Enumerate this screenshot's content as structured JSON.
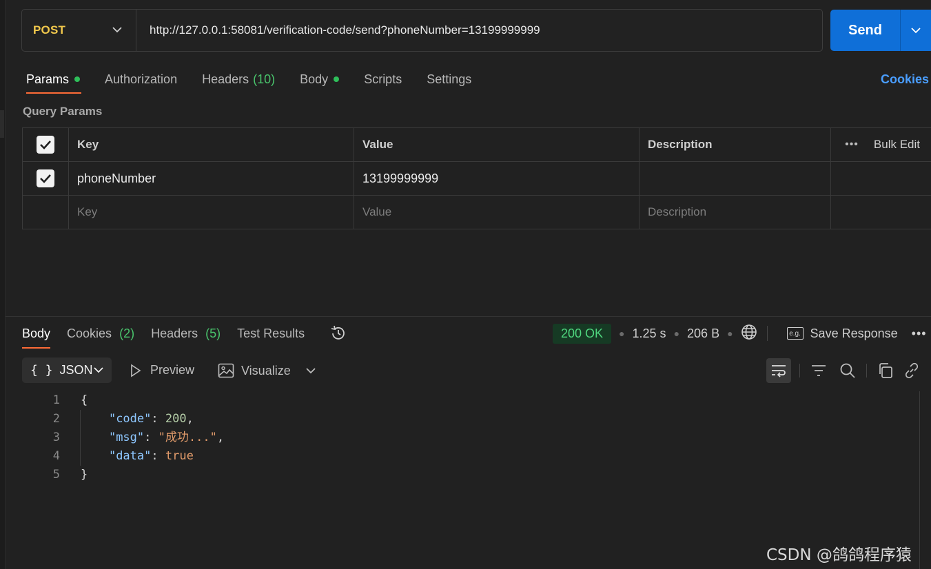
{
  "request": {
    "method": "POST",
    "url": "http://127.0.0.1:58081/verification-code/send?phoneNumber=13199999999",
    "send_label": "Send"
  },
  "request_tabs": [
    {
      "label": "Params",
      "dot": true,
      "active": true
    },
    {
      "label": "Authorization"
    },
    {
      "label": "Headers",
      "count": "(10)"
    },
    {
      "label": "Body",
      "dot": true
    },
    {
      "label": "Scripts"
    },
    {
      "label": "Settings"
    }
  ],
  "cookies_link": "Cookies",
  "query_params": {
    "title": "Query Params",
    "headers": {
      "key": "Key",
      "value": "Value",
      "description": "Description",
      "bulk_edit": "Bulk Edit"
    },
    "rows": [
      {
        "checked": true,
        "key": "phoneNumber",
        "value": "13199999999",
        "description": ""
      }
    ],
    "placeholder": {
      "key": "Key",
      "value": "Value",
      "description": "Description"
    }
  },
  "response_tabs": [
    {
      "label": "Body",
      "active": true
    },
    {
      "label": "Cookies",
      "count": "(2)"
    },
    {
      "label": "Headers",
      "count": "(5)"
    },
    {
      "label": "Test Results"
    }
  ],
  "response_meta": {
    "status": "200 OK",
    "time": "1.25 s",
    "size": "206 B",
    "save_label": "Save Response",
    "eg_label": "e.g."
  },
  "response_toolbar": {
    "format": "JSON",
    "format_braces": "{ }",
    "preview": "Preview",
    "visualize": "Visualize"
  },
  "code_lines": [
    {
      "n": "1",
      "text": "{"
    },
    {
      "n": "2",
      "text": "\"code\": 200,"
    },
    {
      "n": "3",
      "text": "\"msg\": \"成功...\","
    },
    {
      "n": "4",
      "text": "\"data\": true"
    },
    {
      "n": "5",
      "text": "}"
    }
  ],
  "code_tokens": {
    "code_key": "\"code\"",
    "code_val": "200",
    "msg_key": "\"msg\"",
    "msg_val": "\"成功...\"",
    "data_key": "\"data\"",
    "data_val": "true"
  },
  "watermark": "CSDN @鸽鸽程序猿",
  "colors": {
    "accent": "#ff6c37",
    "send": "#0f6fd8",
    "method": "#f2c94c",
    "status_ok": "#4fd77f",
    "dot": "#2fbf5a"
  }
}
